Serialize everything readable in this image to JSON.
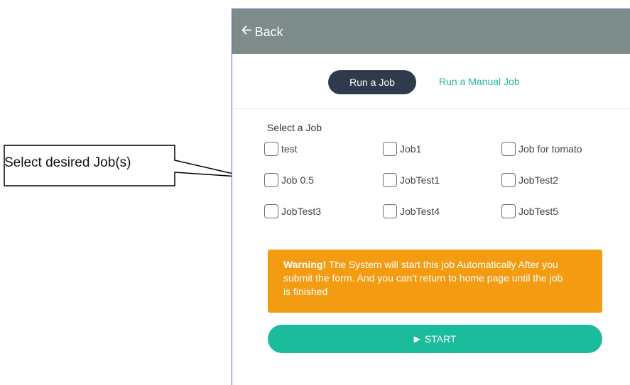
{
  "callout": {
    "text": "Select desired Job(s)"
  },
  "header": {
    "back_label": "Back"
  },
  "tabs": {
    "active": "Run a Job",
    "secondary": "Run a Manual Job"
  },
  "form": {
    "select_label": "Select a Job",
    "jobs": [
      "test",
      "Job1",
      "Job for tomato",
      "Job 0.5",
      "JobTest1",
      "JobTest2",
      "JobTest3",
      "JobTest4",
      "JobTest5"
    ]
  },
  "warning": {
    "title": "Warning!",
    "body": " The System will start this job Automatically After you submit the form. And you can't return to home page until the job is finished"
  },
  "start": {
    "label": "START"
  },
  "colors": {
    "topbar": "#7d8b8b",
    "active_tab": "#2f3b4c",
    "link": "#27b89a",
    "warning": "#f39c12",
    "start": "#1abc9c"
  }
}
